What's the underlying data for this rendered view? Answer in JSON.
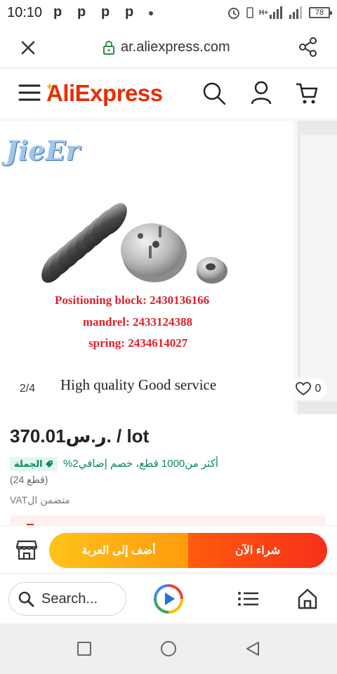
{
  "status_bar": {
    "time": "10:10",
    "notification_icons": [
      "p",
      "p",
      "p",
      "p"
    ],
    "network": "H+",
    "battery": "78"
  },
  "browser": {
    "url": "ar.aliexpress.com",
    "close_icon": "close-icon",
    "lock_icon": "lock-icon",
    "share_icon": "share-icon"
  },
  "header": {
    "logo": "AliExpress",
    "brand_color": "#e62e04",
    "icons": [
      "menu-icon",
      "search-icon",
      "user-icon",
      "cart-icon"
    ]
  },
  "gallery": {
    "watermark": "JieEr",
    "spec_lines": [
      "Positioning block:  2430136166",
      "mandrel:  2433124388",
      "spring:  2434614027"
    ],
    "tagline": "High quality   Good service",
    "pager": "2/4",
    "wishlist_count": "0"
  },
  "product": {
    "price": "370.01ر.س. / lot",
    "wholesale_badge": "الجملة",
    "discount_text": "%أكثر من1000 قطع، خصم إضافي2",
    "min_qty": "(قطع 24)",
    "vat_note": "VATمتضمن ال",
    "accent_green": "#0b8a5a"
  },
  "actions": {
    "add_to_cart": "أضف إلى العربة",
    "buy_now": "شراء الآن",
    "store_icon": "store-icon"
  },
  "browser_bottom": {
    "search_placeholder": "Search...",
    "icons": [
      "search-icon",
      "assistant-play-icon",
      "list-icon",
      "home-icon"
    ]
  },
  "android_nav": {
    "icons": [
      "recent-apps-icon",
      "home-circle-icon",
      "back-triangle-icon"
    ]
  }
}
